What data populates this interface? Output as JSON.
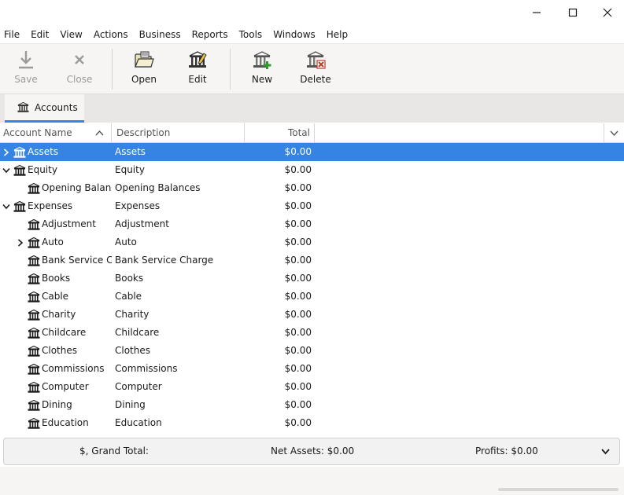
{
  "window": {
    "controls": [
      "minimize-icon",
      "maximize-icon",
      "close-icon"
    ]
  },
  "menu": [
    "File",
    "Edit",
    "View",
    "Actions",
    "Business",
    "Reports",
    "Tools",
    "Windows",
    "Help"
  ],
  "toolbar": {
    "save": {
      "label": "Save",
      "icon": "save-icon",
      "enabled": false
    },
    "close": {
      "label": "Close",
      "icon": "close-icon",
      "enabled": false
    },
    "open": {
      "label": "Open",
      "icon": "open-folder-icon",
      "enabled": true
    },
    "edit": {
      "label": "Edit",
      "icon": "edit-account-icon",
      "enabled": true
    },
    "new": {
      "label": "New",
      "icon": "new-account-icon",
      "enabled": true
    },
    "delete": {
      "label": "Delete",
      "icon": "delete-account-icon",
      "enabled": true
    }
  },
  "tabs": [
    {
      "label": "Accounts",
      "icon": "bank-icon",
      "active": true
    }
  ],
  "columns": {
    "name": "Account Name",
    "description": "Description",
    "total": "Total"
  },
  "accounts": [
    {
      "name": "Assets",
      "description": "Assets",
      "total": "$0.00",
      "level": 0,
      "expander": "collapsed",
      "selected": true
    },
    {
      "name": "Equity",
      "description": "Equity",
      "total": "$0.00",
      "level": 0,
      "expander": "expanded",
      "selected": false
    },
    {
      "name": "Opening Balances",
      "description": "Opening Balances",
      "total": "$0.00",
      "level": 1,
      "expander": "none",
      "selected": false
    },
    {
      "name": "Expenses",
      "description": "Expenses",
      "total": "$0.00",
      "level": 0,
      "expander": "expanded",
      "selected": false
    },
    {
      "name": "Adjustment",
      "description": "Adjustment",
      "total": "$0.00",
      "level": 1,
      "expander": "none",
      "selected": false
    },
    {
      "name": "Auto",
      "description": "Auto",
      "total": "$0.00",
      "level": 1,
      "expander": "collapsed",
      "selected": false
    },
    {
      "name": "Bank Service Charge",
      "description": "Bank Service Charge",
      "total": "$0.00",
      "level": 1,
      "expander": "none",
      "selected": false
    },
    {
      "name": "Books",
      "description": "Books",
      "total": "$0.00",
      "level": 1,
      "expander": "none",
      "selected": false
    },
    {
      "name": "Cable",
      "description": "Cable",
      "total": "$0.00",
      "level": 1,
      "expander": "none",
      "selected": false
    },
    {
      "name": "Charity",
      "description": "Charity",
      "total": "$0.00",
      "level": 1,
      "expander": "none",
      "selected": false
    },
    {
      "name": "Childcare",
      "description": "Childcare",
      "total": "$0.00",
      "level": 1,
      "expander": "none",
      "selected": false
    },
    {
      "name": "Clothes",
      "description": "Clothes",
      "total": "$0.00",
      "level": 1,
      "expander": "none",
      "selected": false
    },
    {
      "name": "Commissions",
      "description": "Commissions",
      "total": "$0.00",
      "level": 1,
      "expander": "none",
      "selected": false
    },
    {
      "name": "Computer",
      "description": "Computer",
      "total": "$0.00",
      "level": 1,
      "expander": "none",
      "selected": false
    },
    {
      "name": "Dining",
      "description": "Dining",
      "total": "$0.00",
      "level": 1,
      "expander": "none",
      "selected": false
    },
    {
      "name": "Education",
      "description": "Education",
      "total": "$0.00",
      "level": 1,
      "expander": "none",
      "selected": false
    },
    {
      "name": "",
      "description": "",
      "total": "",
      "level": 1,
      "expander": "none",
      "selected": false
    }
  ],
  "summary": {
    "grand_total": "$, Grand Total:",
    "net_assets": "Net Assets: $0.00",
    "profits": "Profits: $0.00"
  },
  "colors": {
    "selection": "#3584e4",
    "tab_indicator": "#3584e4"
  }
}
